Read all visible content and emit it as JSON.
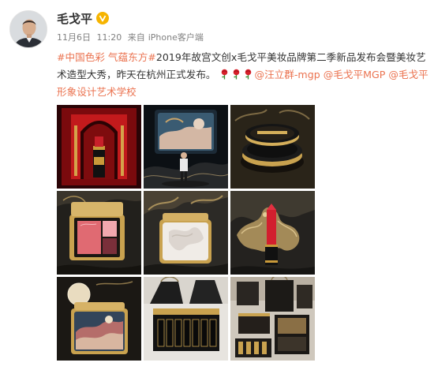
{
  "post": {
    "author": {
      "name": "毛戈平"
    },
    "meta": {
      "date": "11月6日",
      "time": "11:20",
      "source_prefix": "来自",
      "source": "iPhone客户端"
    },
    "text": {
      "topic": "#中国色彩 气蕴东方#",
      "body": "2019年故宫文创x毛戈平美妆品牌第二季新品发布会暨美妆艺术造型大秀，昨天在杭州正式发布。",
      "mentions": [
        "@汪立群-mgp",
        "@毛戈平MGP",
        "@毛戈平形象设计艺术学校"
      ]
    },
    "images": [
      {
        "subject": "lipstick-red-gate"
      },
      {
        "subject": "launch-stage-screen"
      },
      {
        "subject": "gold-cushion-compact"
      },
      {
        "subject": "blush-palette"
      },
      {
        "subject": "highlighter-dragon"
      },
      {
        "subject": "dragon-red-lipstick"
      },
      {
        "subject": "eyeshadow-palette-moon"
      },
      {
        "subject": "lipstick-gift-box"
      },
      {
        "subject": "gift-bags-packaging"
      }
    ],
    "colors": {
      "link": "#eb7350",
      "text": "#333333",
      "meta": "#808080",
      "verified_badge": "#f6b400"
    },
    "icons": {
      "verified": "verified-v-icon",
      "rose": "rose-emoji-icon"
    }
  }
}
